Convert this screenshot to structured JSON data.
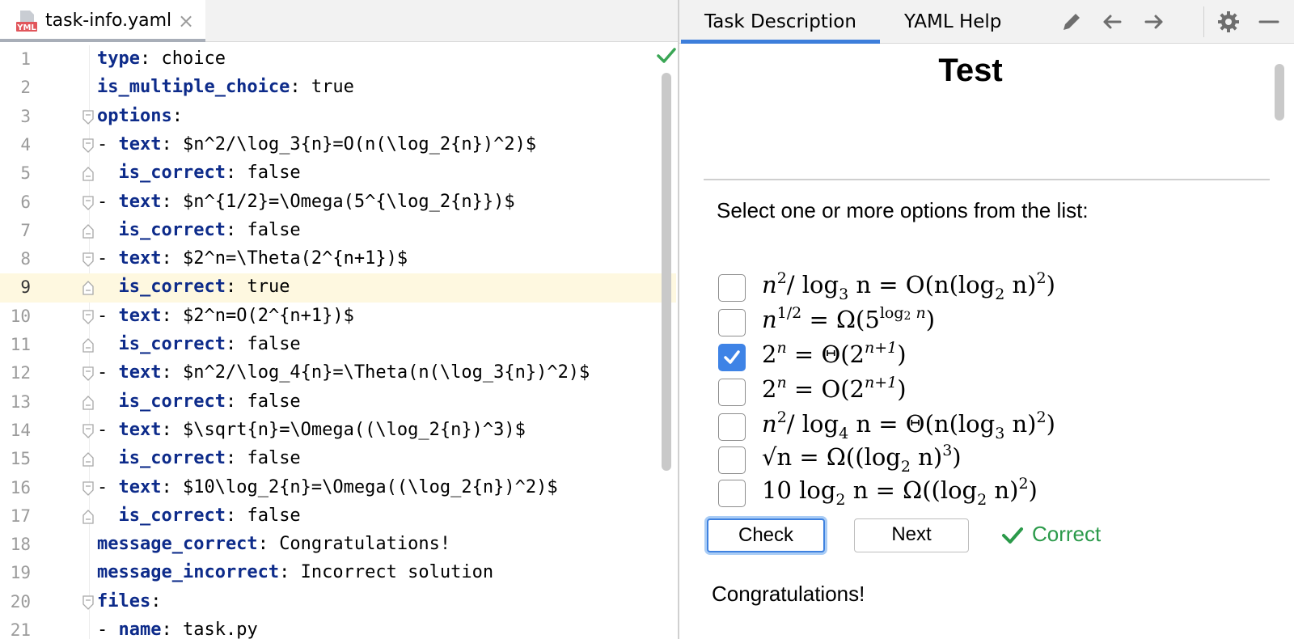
{
  "editor": {
    "tab": {
      "icon_text": "YML",
      "title": "task-info.yaml",
      "close": "×"
    },
    "lines": [
      {
        "num": "1",
        "key": "type",
        "sep": ": ",
        "val": "choice"
      },
      {
        "num": "2",
        "key": "is_multiple_choice",
        "sep": ": ",
        "val": "true"
      },
      {
        "num": "3",
        "key": "options",
        "sep": ":",
        "val": ""
      },
      {
        "num": "4",
        "pre": "- ",
        "key": "text",
        "sep": ": ",
        "val": "$n^2/\\log_3{n}=O(n(\\log_2{n})^2)$"
      },
      {
        "num": "5",
        "pre": "  ",
        "key": "is_correct",
        "sep": ": ",
        "val": "false"
      },
      {
        "num": "6",
        "pre": "- ",
        "key": "text",
        "sep": ": ",
        "val": "$n^{1/2}=\\Omega(5^{\\log_2{n}})$"
      },
      {
        "num": "7",
        "pre": "  ",
        "key": "is_correct",
        "sep": ": ",
        "val": "false"
      },
      {
        "num": "8",
        "pre": "- ",
        "key": "text",
        "sep": ": ",
        "val": "$2^n=\\Theta(2^{n+1})$"
      },
      {
        "num": "9",
        "pre": "  ",
        "key": "is_correct",
        "sep": ": ",
        "val": "true"
      },
      {
        "num": "10",
        "pre": "- ",
        "key": "text",
        "sep": ": ",
        "val": "$2^n=O(2^{n+1})$"
      },
      {
        "num": "11",
        "pre": "  ",
        "key": "is_correct",
        "sep": ": ",
        "val": "false"
      },
      {
        "num": "12",
        "pre": "- ",
        "key": "text",
        "sep": ": ",
        "val": "$n^2/\\log_4{n}=\\Theta(n(\\log_3{n})^2)$"
      },
      {
        "num": "13",
        "pre": "  ",
        "key": "is_correct",
        "sep": ": ",
        "val": "false"
      },
      {
        "num": "14",
        "pre": "- ",
        "key": "text",
        "sep": ": ",
        "val": "$\\sqrt{n}=\\Omega((\\log_2{n})^3)$"
      },
      {
        "num": "15",
        "pre": "  ",
        "key": "is_correct",
        "sep": ": ",
        "val": "false"
      },
      {
        "num": "16",
        "pre": "- ",
        "key": "text",
        "sep": ": ",
        "val": "$10\\log_2{n}=\\Omega((\\log_2{n})^2)$"
      },
      {
        "num": "17",
        "pre": "  ",
        "key": "is_correct",
        "sep": ": ",
        "val": "false"
      },
      {
        "num": "18",
        "key": "message_correct",
        "sep": ": ",
        "val": "Congratulations!"
      },
      {
        "num": "19",
        "key": "message_incorrect",
        "sep": ": ",
        "val": "Incorrect solution"
      },
      {
        "num": "20",
        "key": "files",
        "sep": ":",
        "val": ""
      },
      {
        "num": "21",
        "pre": "- ",
        "key": "name",
        "sep": ": ",
        "val": "task.py"
      }
    ]
  },
  "task_panel": {
    "tabs": {
      "description": "Task Description",
      "yaml_help": "YAML Help"
    },
    "icons": [
      "pencil-icon",
      "arrow-left-icon",
      "arrow-right-icon",
      "gear-icon",
      "minimize-icon"
    ],
    "title": "Test",
    "prompt": "Select one or more options from the list:",
    "options": [
      {
        "checked": false,
        "p": [
          "n",
          "2",
          "/ log",
          "3",
          " n = O(n(log",
          "2",
          " n)",
          "2",
          ")"
        ]
      },
      {
        "checked": false,
        "p": [
          "n",
          "1/2",
          " = Ω(5",
          "log",
          "2",
          " n",
          ")"
        ]
      },
      {
        "checked": true,
        "p": [
          "2",
          "n",
          " = Θ(2",
          "n+1",
          ")"
        ]
      },
      {
        "checked": false,
        "p": [
          "2",
          "n",
          " = O(2",
          "n+1",
          ")"
        ]
      },
      {
        "checked": false,
        "p": [
          "n",
          "2",
          "/ log",
          "4",
          " n = Θ(n(log",
          "3",
          " n)",
          "2",
          ")"
        ]
      },
      {
        "checked": false,
        "p": [
          "√n",
          " = Ω((log",
          "2",
          " n)",
          "3",
          ")"
        ]
      },
      {
        "checked": false,
        "p": [
          "10 log",
          "2",
          " n = Ω((log",
          "2",
          " n)",
          "2",
          ")"
        ]
      }
    ],
    "buttons": {
      "check": "Check",
      "next": "Next"
    },
    "status": "Correct",
    "feedback": "Congratulations!",
    "colors": {
      "accent": "#3d7edb",
      "success": "#2b9a4a",
      "keyword": "#0d2b8a",
      "line_highlight": "#fef8e0"
    }
  }
}
